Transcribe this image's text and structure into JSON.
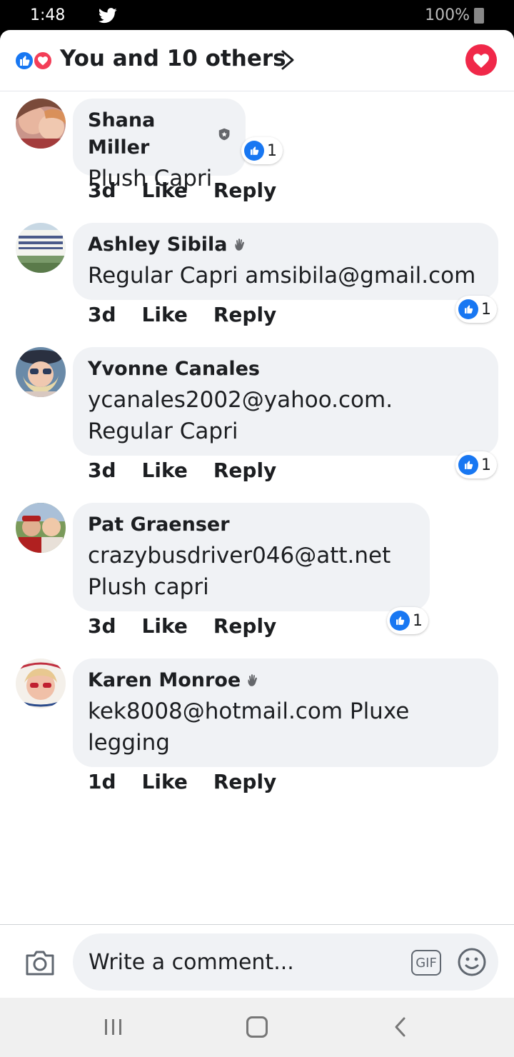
{
  "status_bar": {
    "time": "1:48",
    "battery": "100%"
  },
  "header": {
    "reactions_summary": "You and 10 others"
  },
  "comments": [
    {
      "author": "Shana Miller",
      "badge": "shield-badge",
      "text_lines": [
        "Plush Capri"
      ],
      "age": "3d",
      "like_label": "Like",
      "reply_label": "Reply",
      "reaction_count": "1"
    },
    {
      "author": "Ashley Sibila",
      "badge": "wave-badge",
      "text_lines": [
        "Regular Capri amsibila@gmail.com"
      ],
      "age": "3d",
      "like_label": "Like",
      "reply_label": "Reply",
      "reaction_count": "1"
    },
    {
      "author": "Yvonne Canales",
      "badge": "",
      "text_lines": [
        "ycanales2002@yahoo.com.",
        "Regular Capri"
      ],
      "age": "3d",
      "like_label": "Like",
      "reply_label": "Reply",
      "reaction_count": "1"
    },
    {
      "author": "Pat Graenser",
      "badge": "",
      "text_lines": [
        "crazybusdriver046@att.net",
        "Plush capri"
      ],
      "age": "3d",
      "like_label": "Like",
      "reply_label": "Reply",
      "reaction_count": "1"
    },
    {
      "author": "Karen Monroe",
      "badge": "wave-badge",
      "text_lines": [
        "kek8008@hotmail.com Pluxe",
        "legging"
      ],
      "age": "1d",
      "like_label": "Like",
      "reply_label": "Reply",
      "reaction_count": ""
    }
  ],
  "composer": {
    "placeholder": "Write a comment...",
    "gif_label": "GIF"
  },
  "colors": {
    "like_blue": "#1877f2",
    "love_red": "#f33e58",
    "bubble_gray": "#f0f2f5"
  }
}
